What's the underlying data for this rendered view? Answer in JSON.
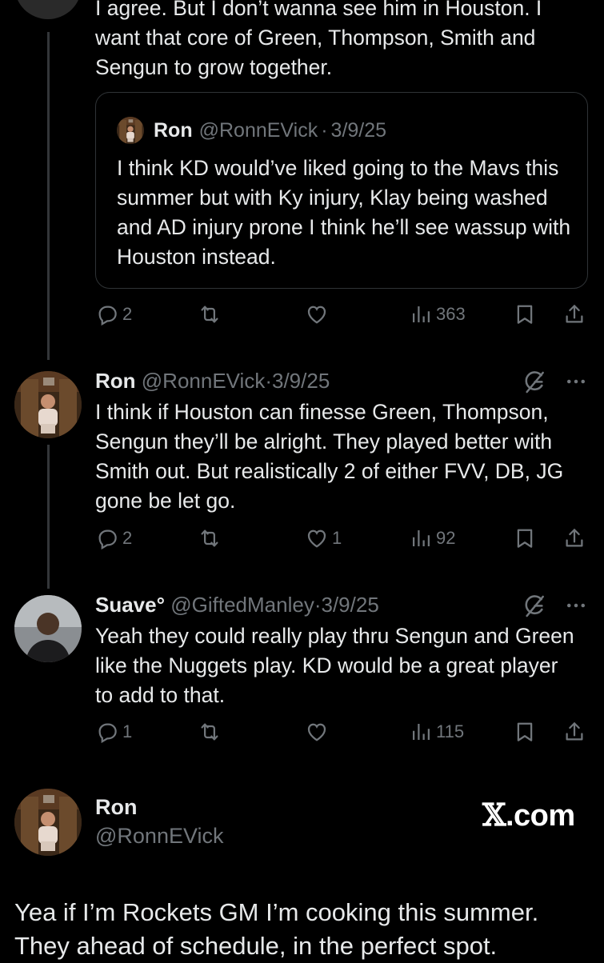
{
  "tweet_top": {
    "text_line1": "I agree. But I don’t wanna see him in Houston. I",
    "text_line2": "want that core of Green, Thompson, Smith and",
    "text_line3": "Sengun to grow together.",
    "quote": {
      "name": "Ron",
      "handle": "@RonnEVick",
      "separator": "·",
      "date": "3/9/25",
      "text": "I think KD would’ve liked going to the Mavs this summer but with Ky injury, Klay being washed and AD injury prone I think he’ll see wassup with Houston instead."
    },
    "actions": {
      "replies": "2",
      "retweets": "",
      "likes": "",
      "views": "363"
    }
  },
  "tweet_ron": {
    "name": "Ron",
    "handle": "@RonnEVick",
    "separator": "·",
    "date": "3/9/25",
    "text": "I think if Houston can finesse Green, Thompson, Sengun they’ll be alright. They played better with Smith out. But realistically 2 of either FVV, DB, JG gone be let go.",
    "actions": {
      "replies": "2",
      "retweets": "",
      "likes": "1",
      "views": "92"
    }
  },
  "tweet_suave": {
    "name": "Suave°",
    "handle": "@GiftedManley",
    "separator": "·",
    "date": "3/9/25",
    "text": "Yeah they could really play thru Sengun and Green like the Nuggets play. KD would be a great player to add to that.",
    "actions": {
      "replies": "1",
      "retweets": "",
      "likes": "",
      "views": "115"
    }
  },
  "main_tweet": {
    "name": "Ron",
    "handle": "@RonnEVick",
    "brand_x": "𝕏",
    "brand_suffix": ".com",
    "text_line1": "Yea if I’m Rockets GM I’m cooking this summer.",
    "text_line2": "They ahead of schedule, in the perfect spot."
  },
  "colors": {
    "background": "#000000",
    "text": "#e7e9ea",
    "muted": "#71767b",
    "border": "#2f3336"
  },
  "icons": [
    "reply-icon",
    "retweet-icon",
    "like-icon",
    "views-icon",
    "bookmark-icon",
    "share-icon",
    "grok-icon",
    "more-icon"
  ]
}
